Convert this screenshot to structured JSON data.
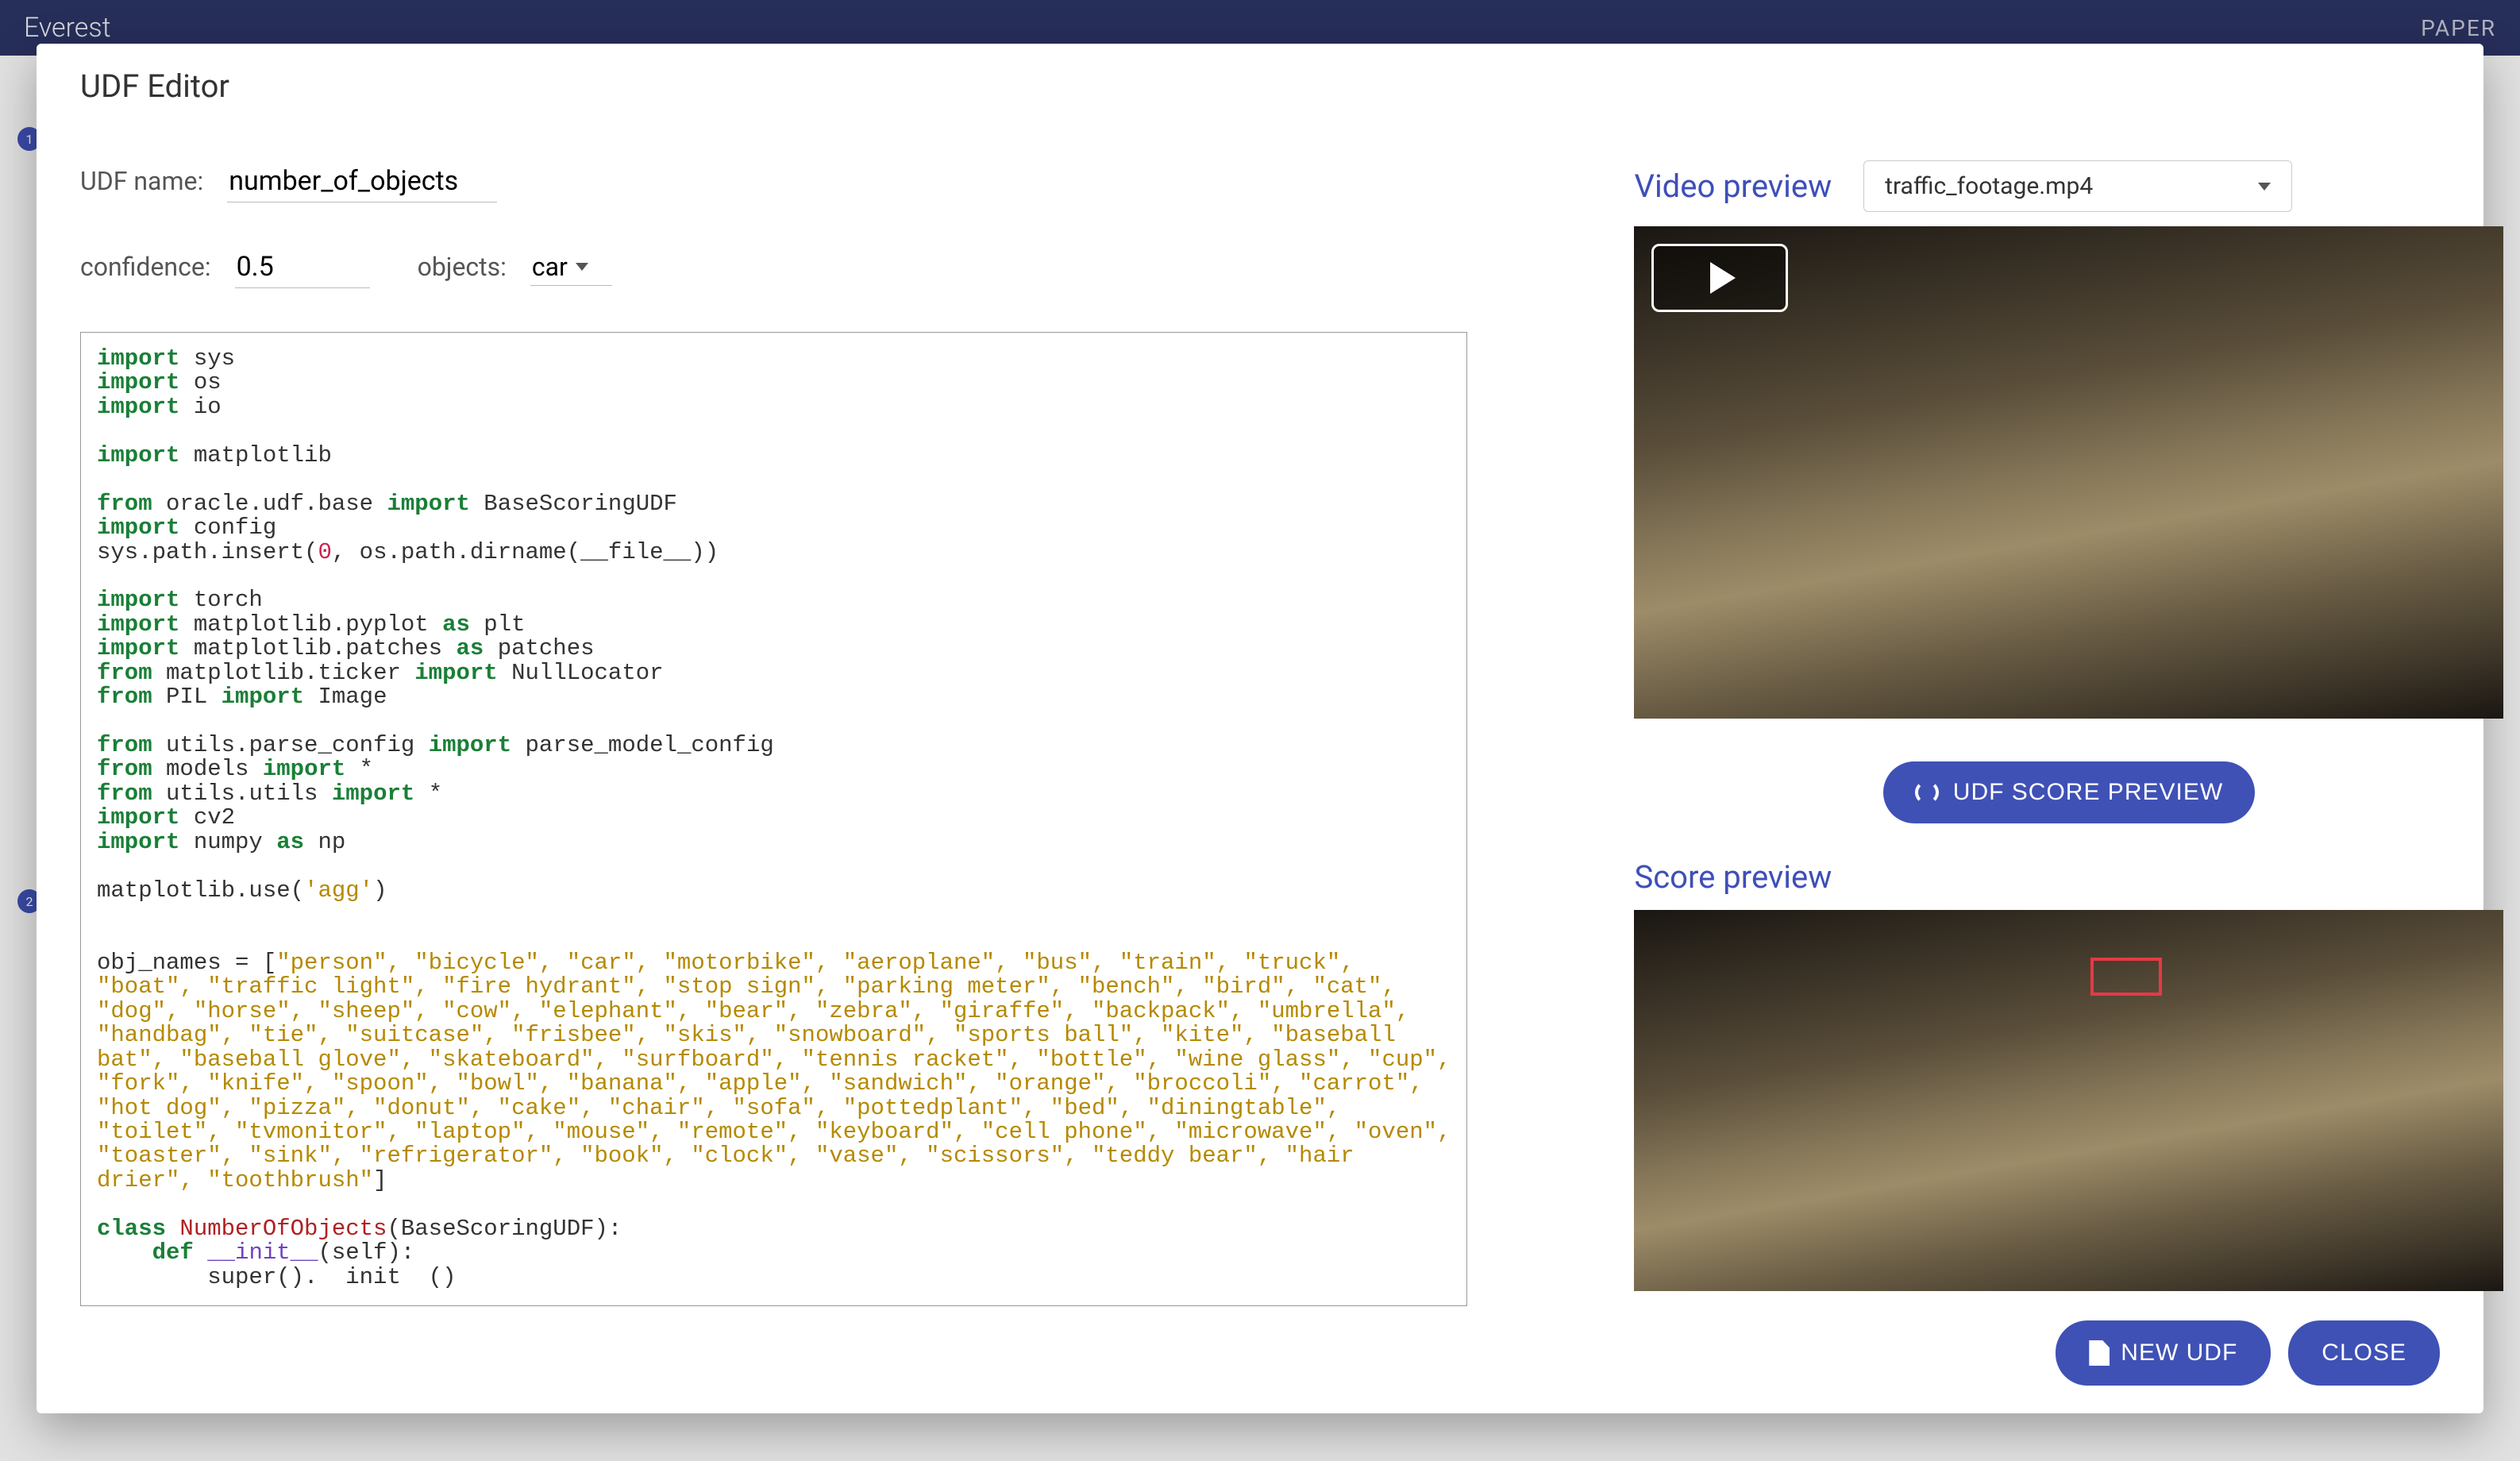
{
  "app": {
    "title": "Everest",
    "header_link": "PAPER"
  },
  "bg": {
    "badge1": "1",
    "badge2": "2"
  },
  "modal": {
    "title": "UDF Editor",
    "udf_name_label": "UDF name:",
    "udf_name_value": "number_of_objects",
    "confidence_label": "confidence:",
    "confidence_value": "0.5",
    "objects_label": "objects:",
    "objects_value": "car",
    "video_preview_title": "Video preview",
    "video_select_value": "traffic_footage.mp4",
    "score_preview_title": "Score preview",
    "udf_score_button": "UDF SCORE PREVIEW",
    "new_udf_button": "NEW UDF",
    "close_button": "CLOSE",
    "code_lines": [
      {
        "t": "import-line",
        "kw": "import",
        "rest": " sys"
      },
      {
        "t": "import-line",
        "kw": "import",
        "rest": " os"
      },
      {
        "t": "import-line",
        "kw": "import",
        "rest": " io"
      },
      {
        "t": "blank"
      },
      {
        "t": "import-line",
        "kw": "import",
        "rest": " matplotlib"
      },
      {
        "t": "blank"
      },
      {
        "t": "from-import",
        "kw1": "from",
        "mid": " oracle.udf.base ",
        "kw2": "import",
        "rest": " BaseScoringUDF"
      },
      {
        "t": "import-line",
        "kw": "import",
        "rest": " config"
      },
      {
        "t": "plain",
        "text": "sys.path.insert(",
        "num": "0",
        "text2": ", os.path.dirname(__file__))"
      },
      {
        "t": "blank"
      },
      {
        "t": "import-line",
        "kw": "import",
        "rest": " torch"
      },
      {
        "t": "import-as",
        "kw1": "import",
        "mid": " matplotlib.pyplot ",
        "kw2": "as",
        "rest": " plt"
      },
      {
        "t": "import-as",
        "kw1": "import",
        "mid": " matplotlib.patches ",
        "kw2": "as",
        "rest": " patches"
      },
      {
        "t": "from-import",
        "kw1": "from",
        "mid": " matplotlib.ticker ",
        "kw2": "import",
        "rest": " NullLocator"
      },
      {
        "t": "from-import",
        "kw1": "from",
        "mid": " PIL ",
        "kw2": "import",
        "rest": " Image"
      },
      {
        "t": "blank"
      },
      {
        "t": "from-import",
        "kw1": "from",
        "mid": " utils.parse_config ",
        "kw2": "import",
        "rest": " parse_model_config"
      },
      {
        "t": "from-import-star",
        "kw1": "from",
        "mid": " models ",
        "kw2": "import",
        "star": " *"
      },
      {
        "t": "from-import-star",
        "kw1": "from",
        "mid": " utils.utils ",
        "kw2": "import",
        "star": " *"
      },
      {
        "t": "import-line",
        "kw": "import",
        "rest": " cv2"
      },
      {
        "t": "import-as",
        "kw1": "import",
        "mid": " numpy ",
        "kw2": "as",
        "rest": " np"
      },
      {
        "t": "blank"
      },
      {
        "t": "use-line",
        "pre": "matplotlib.use(",
        "str": "'agg'",
        "post": ")"
      },
      {
        "t": "blank"
      },
      {
        "t": "blank"
      },
      {
        "t": "obj-line",
        "pre": "obj_names = [",
        "strs": "\"person\", \"bicycle\", \"car\", \"motorbike\", \"aeroplane\", \"bus\", \"train\", \"truck\","
      },
      {
        "t": "obj-cont",
        "strs": "\"boat\", \"traffic light\", \"fire hydrant\", \"stop sign\", \"parking meter\", \"bench\", \"bird\", \"cat\","
      },
      {
        "t": "obj-cont",
        "strs": "\"dog\", \"horse\", \"sheep\", \"cow\", \"elephant\", \"bear\", \"zebra\", \"giraffe\", \"backpack\", \"umbrella\","
      },
      {
        "t": "obj-cont",
        "strs": "\"handbag\", \"tie\", \"suitcase\", \"frisbee\", \"skis\", \"snowboard\", \"sports ball\", \"kite\", \"baseball"
      },
      {
        "t": "obj-cont",
        "strs": "bat\", \"baseball glove\", \"skateboard\", \"surfboard\", \"tennis racket\", \"bottle\", \"wine glass\", \"cup\","
      },
      {
        "t": "obj-cont",
        "strs": "\"fork\", \"knife\", \"spoon\", \"bowl\", \"banana\", \"apple\", \"sandwich\", \"orange\", \"broccoli\", \"carrot\","
      },
      {
        "t": "obj-cont",
        "strs": "\"hot dog\", \"pizza\", \"donut\", \"cake\", \"chair\", \"sofa\", \"pottedplant\", \"bed\", \"diningtable\","
      },
      {
        "t": "obj-cont",
        "strs": "\"toilet\", \"tvmonitor\", \"laptop\", \"mouse\", \"remote\", \"keyboard\", \"cell phone\", \"microwave\", \"oven\","
      },
      {
        "t": "obj-cont",
        "strs": "\"toaster\", \"sink\", \"refrigerator\", \"book\", \"clock\", \"vase\", \"scissors\", \"teddy bear\", \"hair"
      },
      {
        "t": "obj-end",
        "strs": "drier\", \"toothbrush\"",
        "post": "]"
      },
      {
        "t": "blank"
      },
      {
        "t": "class-line",
        "kw": "class",
        "sp": " ",
        "cls": "NumberOfObjects",
        "rest": "(BaseScoringUDF):"
      },
      {
        "t": "def-line",
        "indent": "    ",
        "kw": "def",
        "sp": " ",
        "mag": "__init__",
        "rest": "(self):"
      },
      {
        "t": "super-line",
        "indent": "        ",
        "text": "super().  init  ()"
      }
    ]
  }
}
